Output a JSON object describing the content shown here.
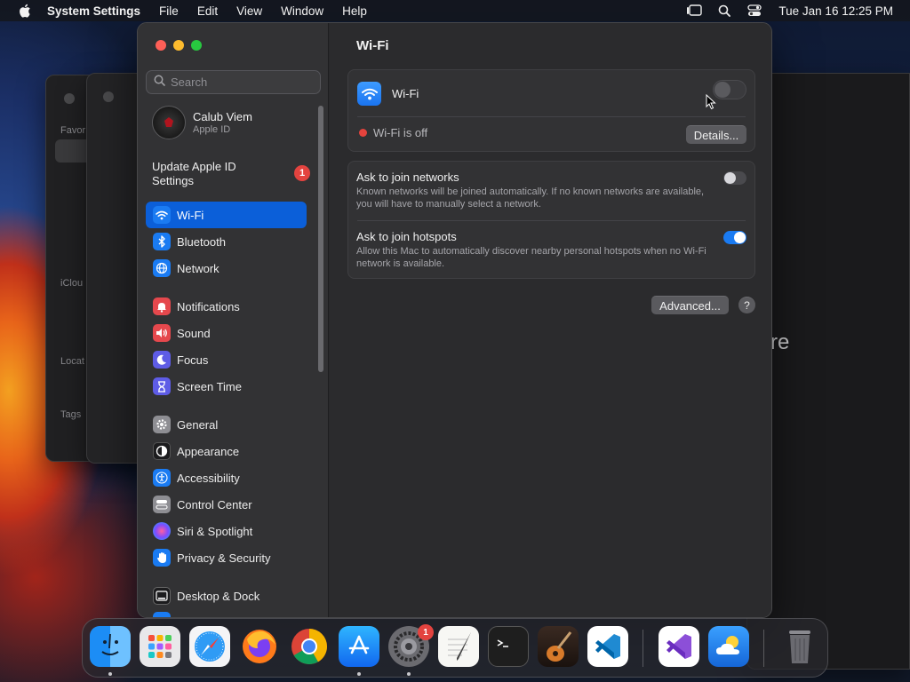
{
  "menubar": {
    "app_name": "System Settings",
    "menus": [
      "File",
      "Edit",
      "View",
      "Window",
      "Help"
    ],
    "clock": "Tue Jan 16  12:25 PM"
  },
  "background": {
    "partial_text": "re",
    "sidebar_fragments": [
      "Favor",
      "iClou",
      "Locat",
      "Tags"
    ]
  },
  "sidebar": {
    "search_placeholder": "Search",
    "profile": {
      "name": "Calub Viem",
      "subtitle": "Apple ID"
    },
    "update": {
      "label": "Update Apple ID Settings",
      "badge": "1"
    },
    "items": [
      {
        "label": "Wi-Fi",
        "icon": "wifi-icon",
        "color": "#1a7bf2",
        "active": true
      },
      {
        "label": "Bluetooth",
        "icon": "bluetooth-icon",
        "color": "#1a7bf2"
      },
      {
        "label": "Network",
        "icon": "globe-icon",
        "color": "#1a7bf2"
      },
      {
        "label": "Notifications",
        "icon": "bell-icon",
        "color": "#e5484d"
      },
      {
        "label": "Sound",
        "icon": "speaker-icon",
        "color": "#e5484d"
      },
      {
        "label": "Focus",
        "icon": "moon-icon",
        "color": "#5e5ce6"
      },
      {
        "label": "Screen Time",
        "icon": "hourglass-icon",
        "color": "#5e5ce6"
      },
      {
        "label": "General",
        "icon": "gear-icon",
        "color": "#8e8e93"
      },
      {
        "label": "Appearance",
        "icon": "appearance-icon",
        "color": "#1c1c1e"
      },
      {
        "label": "Accessibility",
        "icon": "accessibility-icon",
        "color": "#1a7bf2"
      },
      {
        "label": "Control Center",
        "icon": "control-center-icon",
        "color": "#8e8e93"
      },
      {
        "label": "Siri & Spotlight",
        "icon": "siri-icon",
        "color": "#bf5af2"
      },
      {
        "label": "Privacy & Security",
        "icon": "hand-icon",
        "color": "#1a7bf2"
      },
      {
        "label": "Desktop & Dock",
        "icon": "dock-icon",
        "color": "#1c1c1e"
      }
    ]
  },
  "content": {
    "title": "Wi-Fi",
    "wifi": {
      "label": "Wi-Fi",
      "enabled": false,
      "status": "Wi-Fi is off",
      "details_button": "Details..."
    },
    "ask_networks": {
      "title": "Ask to join networks",
      "description": "Known networks will be joined automatically. If no known networks are available, you will have to manually select a network.",
      "enabled": false
    },
    "ask_hotspots": {
      "title": "Ask to join hotspots",
      "description": "Allow this Mac to automatically discover nearby personal hotspots when no Wi-Fi network is available.",
      "enabled": true
    },
    "advanced_button": "Advanced...",
    "help_button": "?"
  },
  "dock": {
    "apps": [
      "finder-icon",
      "launchpad-icon",
      "safari-icon",
      "firefox-icon",
      "chrome-icon",
      "app-store-icon",
      "system-settings-icon",
      "textedit-icon",
      "terminal-icon",
      "garageband-icon",
      "vscode-icon",
      "visual-studio-icon",
      "weather-icon",
      "trash-icon"
    ],
    "settings_badge": "1"
  }
}
